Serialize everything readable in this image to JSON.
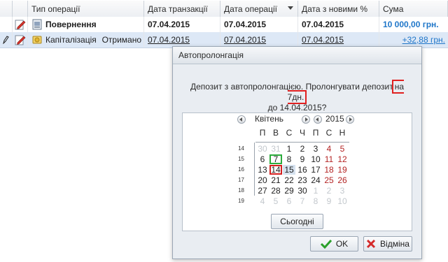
{
  "grid": {
    "columns": [
      "Тип операції",
      "Дата транзакції",
      "Дата операції",
      "Дата з новими %",
      "Сума"
    ],
    "rows": [
      {
        "type": "Повернення",
        "status": "",
        "date_transaction": "07.04.2015",
        "date_operation": "07.04.2015",
        "date_new_percent": "07.04.2015",
        "amount": "10 000,00 грн.",
        "row_icon": "refund-doc-icon"
      },
      {
        "type": "Капіталізація",
        "status": "Отримано",
        "date_transaction": "07.04.2015",
        "date_operation": "07.04.2015",
        "date_new_percent": "07.04.2015",
        "amount": "+32,88 грн.",
        "row_icon": "coins-icon"
      }
    ]
  },
  "dialog": {
    "title": "Автопролонгація",
    "message_part1": "Депозит з автопролонгацією. Пролонгувати депозит",
    "message_days": "на 7дн.",
    "message_line2": "до 14.04.2015?",
    "calendar": {
      "month": "Квітень",
      "year": "2015",
      "weekdays": [
        "П",
        "В",
        "С",
        "Ч",
        "П",
        "С",
        "Н"
      ],
      "weeks": [
        {
          "num": "14",
          "days": [
            "30",
            "31",
            "1",
            "2",
            "3",
            "4",
            "5"
          ]
        },
        {
          "num": "15",
          "days": [
            "6",
            "7",
            "8",
            "9",
            "10",
            "11",
            "12"
          ]
        },
        {
          "num": "16",
          "days": [
            "13",
            "14",
            "15",
            "16",
            "17",
            "18",
            "19"
          ]
        },
        {
          "num": "17",
          "days": [
            "20",
            "21",
            "22",
            "23",
            "24",
            "25",
            "26"
          ]
        },
        {
          "num": "18",
          "days": [
            "27",
            "28",
            "29",
            "30",
            "1",
            "2",
            "3"
          ]
        },
        {
          "num": "19",
          "days": [
            "4",
            "5",
            "6",
            "7",
            "8",
            "9",
            "10"
          ]
        }
      ],
      "today_label": "Сьогодні",
      "highlight_green": "7",
      "highlight_red": "14"
    },
    "ok_label": "OK",
    "cancel_label": "Відміна"
  },
  "colors": {
    "accent_blue": "#1f76c9",
    "selection": "#dde8f6",
    "highlight_red": "#e02020",
    "highlight_green": "#2bab3c",
    "weekend": "#b42424"
  },
  "icons": [
    "pencil-edit-icon",
    "refund-doc-icon",
    "coins-icon",
    "check-icon",
    "x-cancel-icon"
  ]
}
